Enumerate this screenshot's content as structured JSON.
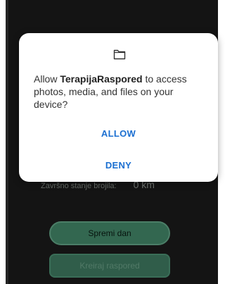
{
  "dialog": {
    "icon": "folder-icon",
    "message_prefix": "Allow ",
    "app_name": "TerapijaRaspored",
    "message_suffix": " to access photos, media, and files on your device?",
    "allow_label": "ALLOW",
    "deny_label": "DENY",
    "accent_color": "#1b6fd1"
  },
  "background": {
    "odometer_label": "Završno stanje brojila:",
    "odometer_value": "0 km",
    "save_button_label": "Spremi dan",
    "create_button_label": "Kreiraj raspored"
  }
}
